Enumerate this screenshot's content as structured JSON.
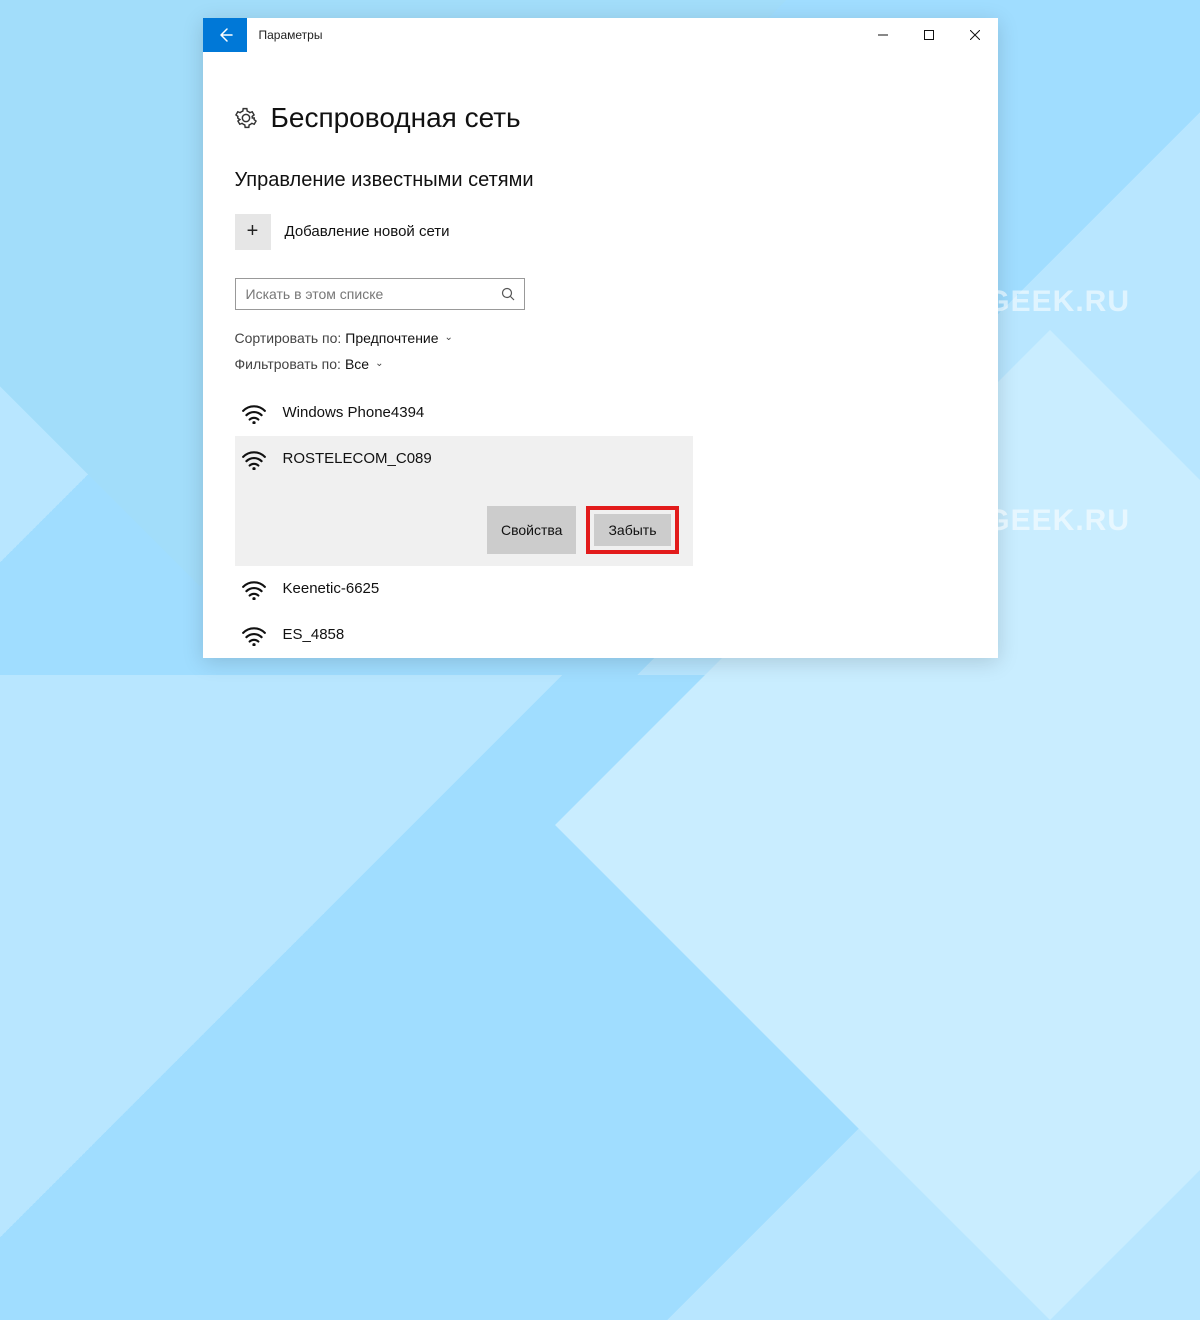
{
  "window": {
    "title": "Параметры"
  },
  "page": {
    "heading": "Беспроводная сеть",
    "section": "Управление известными сетями",
    "add_network": "Добавление новой сети",
    "search_placeholder": "Искать в этом списке",
    "sort_label": "Сортировать по:",
    "sort_value": "Предпочтение",
    "filter_label": "Фильтровать по:",
    "filter_value": "Все"
  },
  "networks": [
    {
      "name": "Windows Phone4394",
      "selected": false
    },
    {
      "name": "ROSTELECOM_C089",
      "selected": true
    },
    {
      "name": "Keenetic-6625",
      "selected": false
    },
    {
      "name": "ES_4858",
      "selected": false
    }
  ],
  "actions": {
    "properties": "Свойства",
    "forget": "Забыть"
  },
  "watermark": "TECH-GEEK.RU"
}
